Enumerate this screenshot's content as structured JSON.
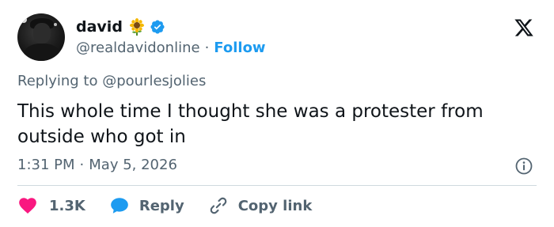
{
  "author": {
    "name": "david",
    "name_emoji": "sunflower-icon",
    "handle": "@realdavidonline",
    "separator": "·",
    "follow_label": "Follow",
    "verified": true
  },
  "tweet": {
    "reply_to": "Replying to @pourlesjolies",
    "text": "This whole time I thought she was a protester from outside who got in",
    "time": "1:31 PM",
    "date_separator": "·",
    "date": "May 5, 2026"
  },
  "actions": {
    "like_count": "1.3K",
    "reply_label": "Reply",
    "copy_link_label": "Copy link"
  },
  "colors": {
    "accent": "#1d9bf0",
    "like": "#f91880",
    "secondary_text": "#536471",
    "primary_text": "#0f1419"
  }
}
